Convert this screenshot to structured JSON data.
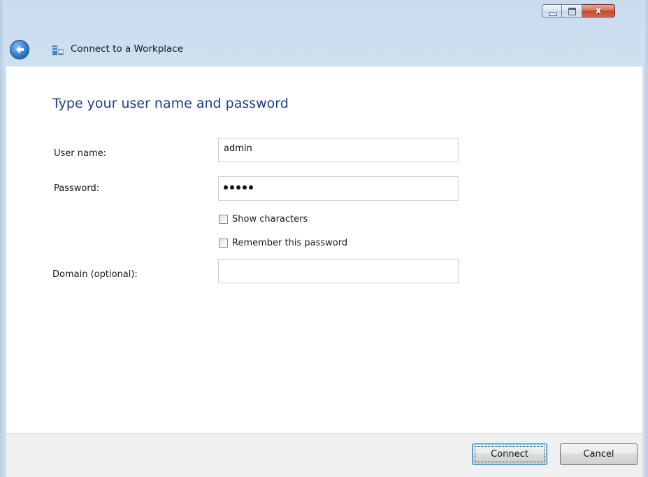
{
  "window": {
    "title": "Connect to a Workplace",
    "controls": {
      "minimize": "minimize",
      "maximize": "maximize",
      "close": "x"
    }
  },
  "page": {
    "heading": "Type your user name and password"
  },
  "form": {
    "username": {
      "label": "User name:",
      "value": "admin"
    },
    "password": {
      "label": "Password:",
      "masked_length": 5
    },
    "show_characters": {
      "label": "Show characters",
      "checked": false
    },
    "remember_password": {
      "label": "Remember this password",
      "checked": false
    },
    "domain": {
      "label": "Domain (optional):",
      "value": ""
    }
  },
  "buttons": {
    "connect": "Connect",
    "cancel": "Cancel"
  },
  "icons": {
    "back": "back-arrow-icon",
    "app": "workplace-network-icon"
  }
}
